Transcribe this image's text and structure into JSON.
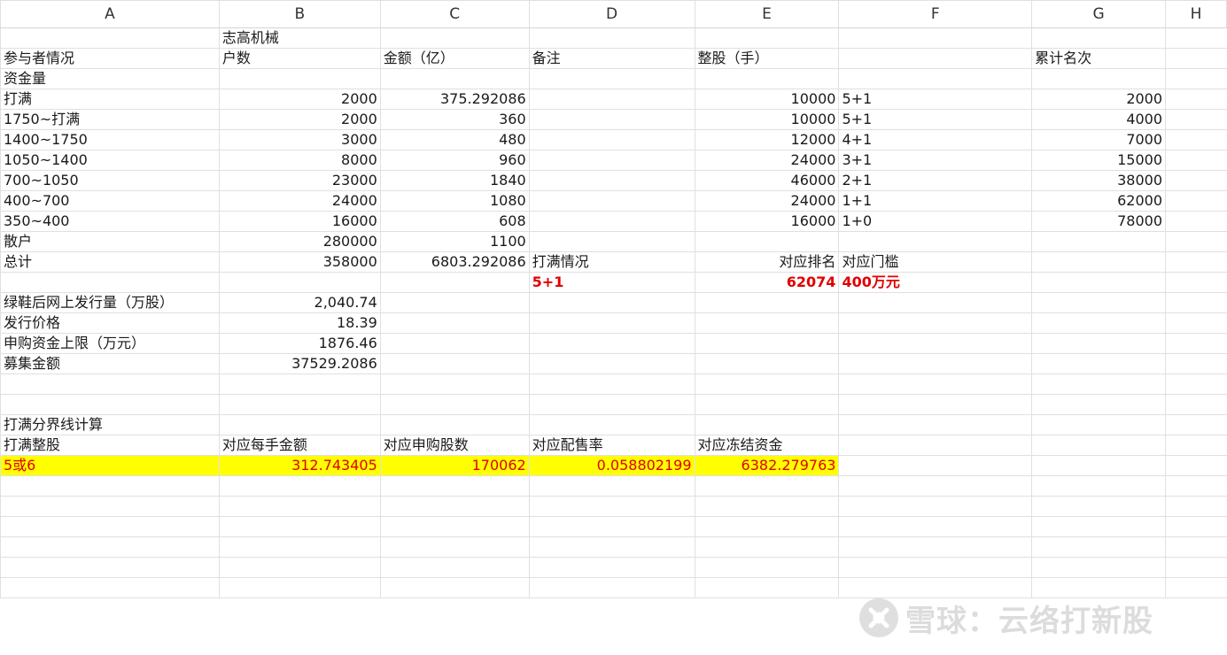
{
  "columns": [
    "A",
    "B",
    "C",
    "D",
    "E",
    "F",
    "G",
    "H"
  ],
  "rows": [
    [
      "",
      "志高机械",
      "",
      "",
      "",
      "",
      "",
      ""
    ],
    [
      "参与者情况",
      "户数",
      "金额（亿）",
      "备注",
      "整股（手）",
      "",
      "累计名次",
      ""
    ],
    [
      "资金量",
      "",
      "",
      "",
      "",
      "",
      "",
      ""
    ],
    [
      "打满",
      "2000",
      "375.292086",
      "",
      "10000",
      "5+1",
      "2000",
      ""
    ],
    [
      "1750~打满",
      "2000",
      "360",
      "",
      "10000",
      "5+1",
      "4000",
      ""
    ],
    [
      "1400~1750",
      "3000",
      "480",
      "",
      "12000",
      "4+1",
      "7000",
      ""
    ],
    [
      "1050~1400",
      "8000",
      "960",
      "",
      "24000",
      "3+1",
      "15000",
      ""
    ],
    [
      "700~1050",
      "23000",
      "1840",
      "",
      "46000",
      "2+1",
      "38000",
      ""
    ],
    [
      "400~700",
      "24000",
      "1080",
      "",
      "24000",
      "1+1",
      "62000",
      ""
    ],
    [
      "350~400",
      "16000",
      "608",
      "",
      "16000",
      "1+0",
      "78000",
      ""
    ],
    [
      "散户",
      "280000",
      "1100",
      "",
      "",
      "",
      "",
      ""
    ],
    [
      "总计",
      "358000",
      "6803.292086",
      "打满情况",
      "对应排名",
      "对应门槛",
      "",
      ""
    ],
    [
      "",
      "",
      "",
      "5+1",
      "62074",
      "400万元",
      "",
      ""
    ],
    [
      "绿鞋后网上发行量（万股）",
      "2,040.74",
      "",
      "",
      "",
      "",
      "",
      ""
    ],
    [
      "发行价格",
      "18.39",
      "",
      "",
      "",
      "",
      "",
      ""
    ],
    [
      "申购资金上限（万元）",
      "1876.46",
      "",
      "",
      "",
      "",
      "",
      ""
    ],
    [
      "募集金额",
      "37529.2086",
      "",
      "",
      "",
      "",
      "",
      ""
    ],
    [
      "",
      "",
      "",
      "",
      "",
      "",
      "",
      ""
    ],
    [
      "",
      "",
      "",
      "",
      "",
      "",
      "",
      ""
    ],
    [
      "打满分界线计算",
      "",
      "",
      "",
      "",
      "",
      "",
      ""
    ],
    [
      "打满整股",
      "对应每手金额",
      "对应申购股数",
      "对应配售率",
      "对应冻结资金",
      "",
      "",
      ""
    ],
    [
      "5或6",
      "312.743405",
      "170062",
      "0.058802199",
      "6382.279763",
      "",
      "",
      ""
    ],
    [
      "",
      "",
      "",
      "",
      "",
      "",
      "",
      ""
    ],
    [
      "",
      "",
      "",
      "",
      "",
      "",
      "",
      ""
    ],
    [
      "",
      "",
      "",
      "",
      "",
      "",
      "",
      ""
    ],
    [
      "",
      "",
      "",
      "",
      "",
      "",
      "",
      ""
    ],
    [
      "",
      "",
      "",
      "",
      "",
      "",
      "",
      ""
    ],
    [
      "",
      "",
      "",
      "",
      "",
      "",
      "",
      ""
    ]
  ],
  "watermark": {
    "text": "雪球：云络打新股",
    "icon": "xueqiu-logo-icon"
  },
  "colors": {
    "highlight": "#ffff00",
    "red_text": "#e00000",
    "grid": "#e0e0e0"
  }
}
